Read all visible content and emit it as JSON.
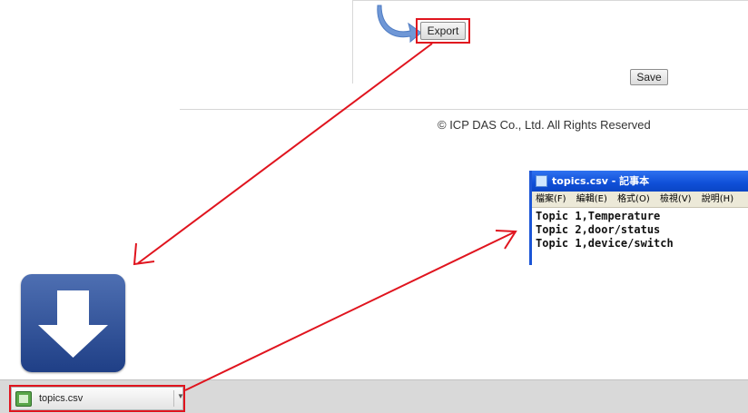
{
  "panel": {
    "export_label": "Export",
    "save_label": "Save"
  },
  "footer": {
    "copyright": "© ICP DAS Co., Ltd. All Rights Reserved"
  },
  "notepad": {
    "title": "topics.csv - 記事本",
    "menu": [
      "檔案(F)",
      "編輯(E)",
      "格式(O)",
      "檢視(V)",
      "說明(H)"
    ],
    "lines": [
      "Topic 1,Temperature",
      "Topic 2,door/status",
      "Topic 1,device/switch"
    ]
  },
  "download_bar": {
    "file_name": "topics.csv",
    "file_icon": "csv-file-icon",
    "menu_icon": "chevron-down-icon"
  },
  "download_icon": "download-arrow-icon",
  "colors": {
    "annotation_red": "#e0141e",
    "curved_arrow_blue": "#6f97d6",
    "notepad_title_blue": "#0f4fd8"
  }
}
